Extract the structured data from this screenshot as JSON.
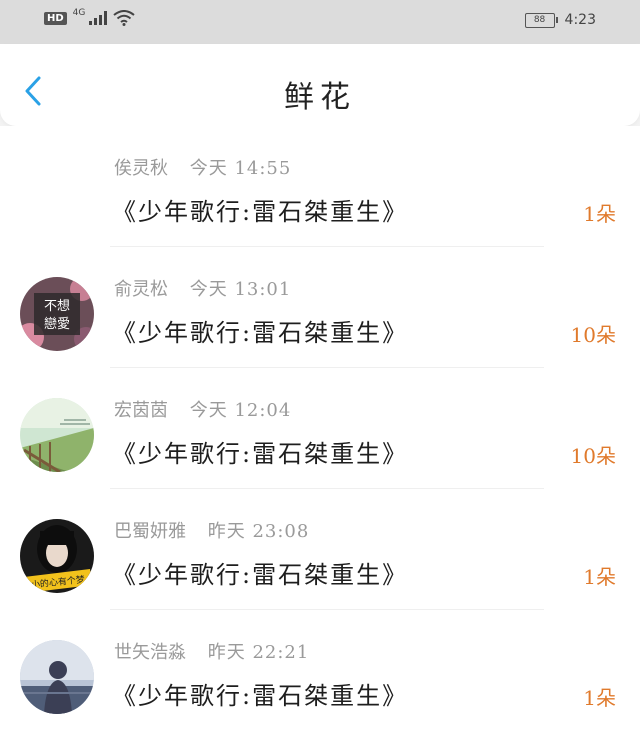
{
  "status_bar": {
    "hd": "HD",
    "network": "4G",
    "battery": "88",
    "time": "4:23"
  },
  "header": {
    "title": "鲜花"
  },
  "items": [
    {
      "name": "俟灵秋",
      "time": "今天 14:55",
      "book": "《少年歌行:雷石桀重生》",
      "count": "1朵"
    },
    {
      "name": "俞灵松",
      "time": "今天 13:01",
      "book": "《少年歌行:雷石桀重生》",
      "count": "10朵"
    },
    {
      "name": "宏茵茵",
      "time": "今天 12:04",
      "book": "《少年歌行:雷石桀重生》",
      "count": "10朵"
    },
    {
      "name": "巴蜀妍雅",
      "time": "昨天 23:08",
      "book": "《少年歌行:雷石桀重生》",
      "count": "1朵"
    },
    {
      "name": "世矢浩淼",
      "time": "昨天 22:21",
      "book": "《少年歌行:雷石桀重生》",
      "count": "1朵"
    }
  ],
  "avatars": {
    "row2_text": "不想戀愛",
    "row4_text": "小的心有个梦"
  },
  "colors": {
    "accent": "#2aa1e6",
    "count": "#e07a2c",
    "meta": "#9a9a9a"
  }
}
